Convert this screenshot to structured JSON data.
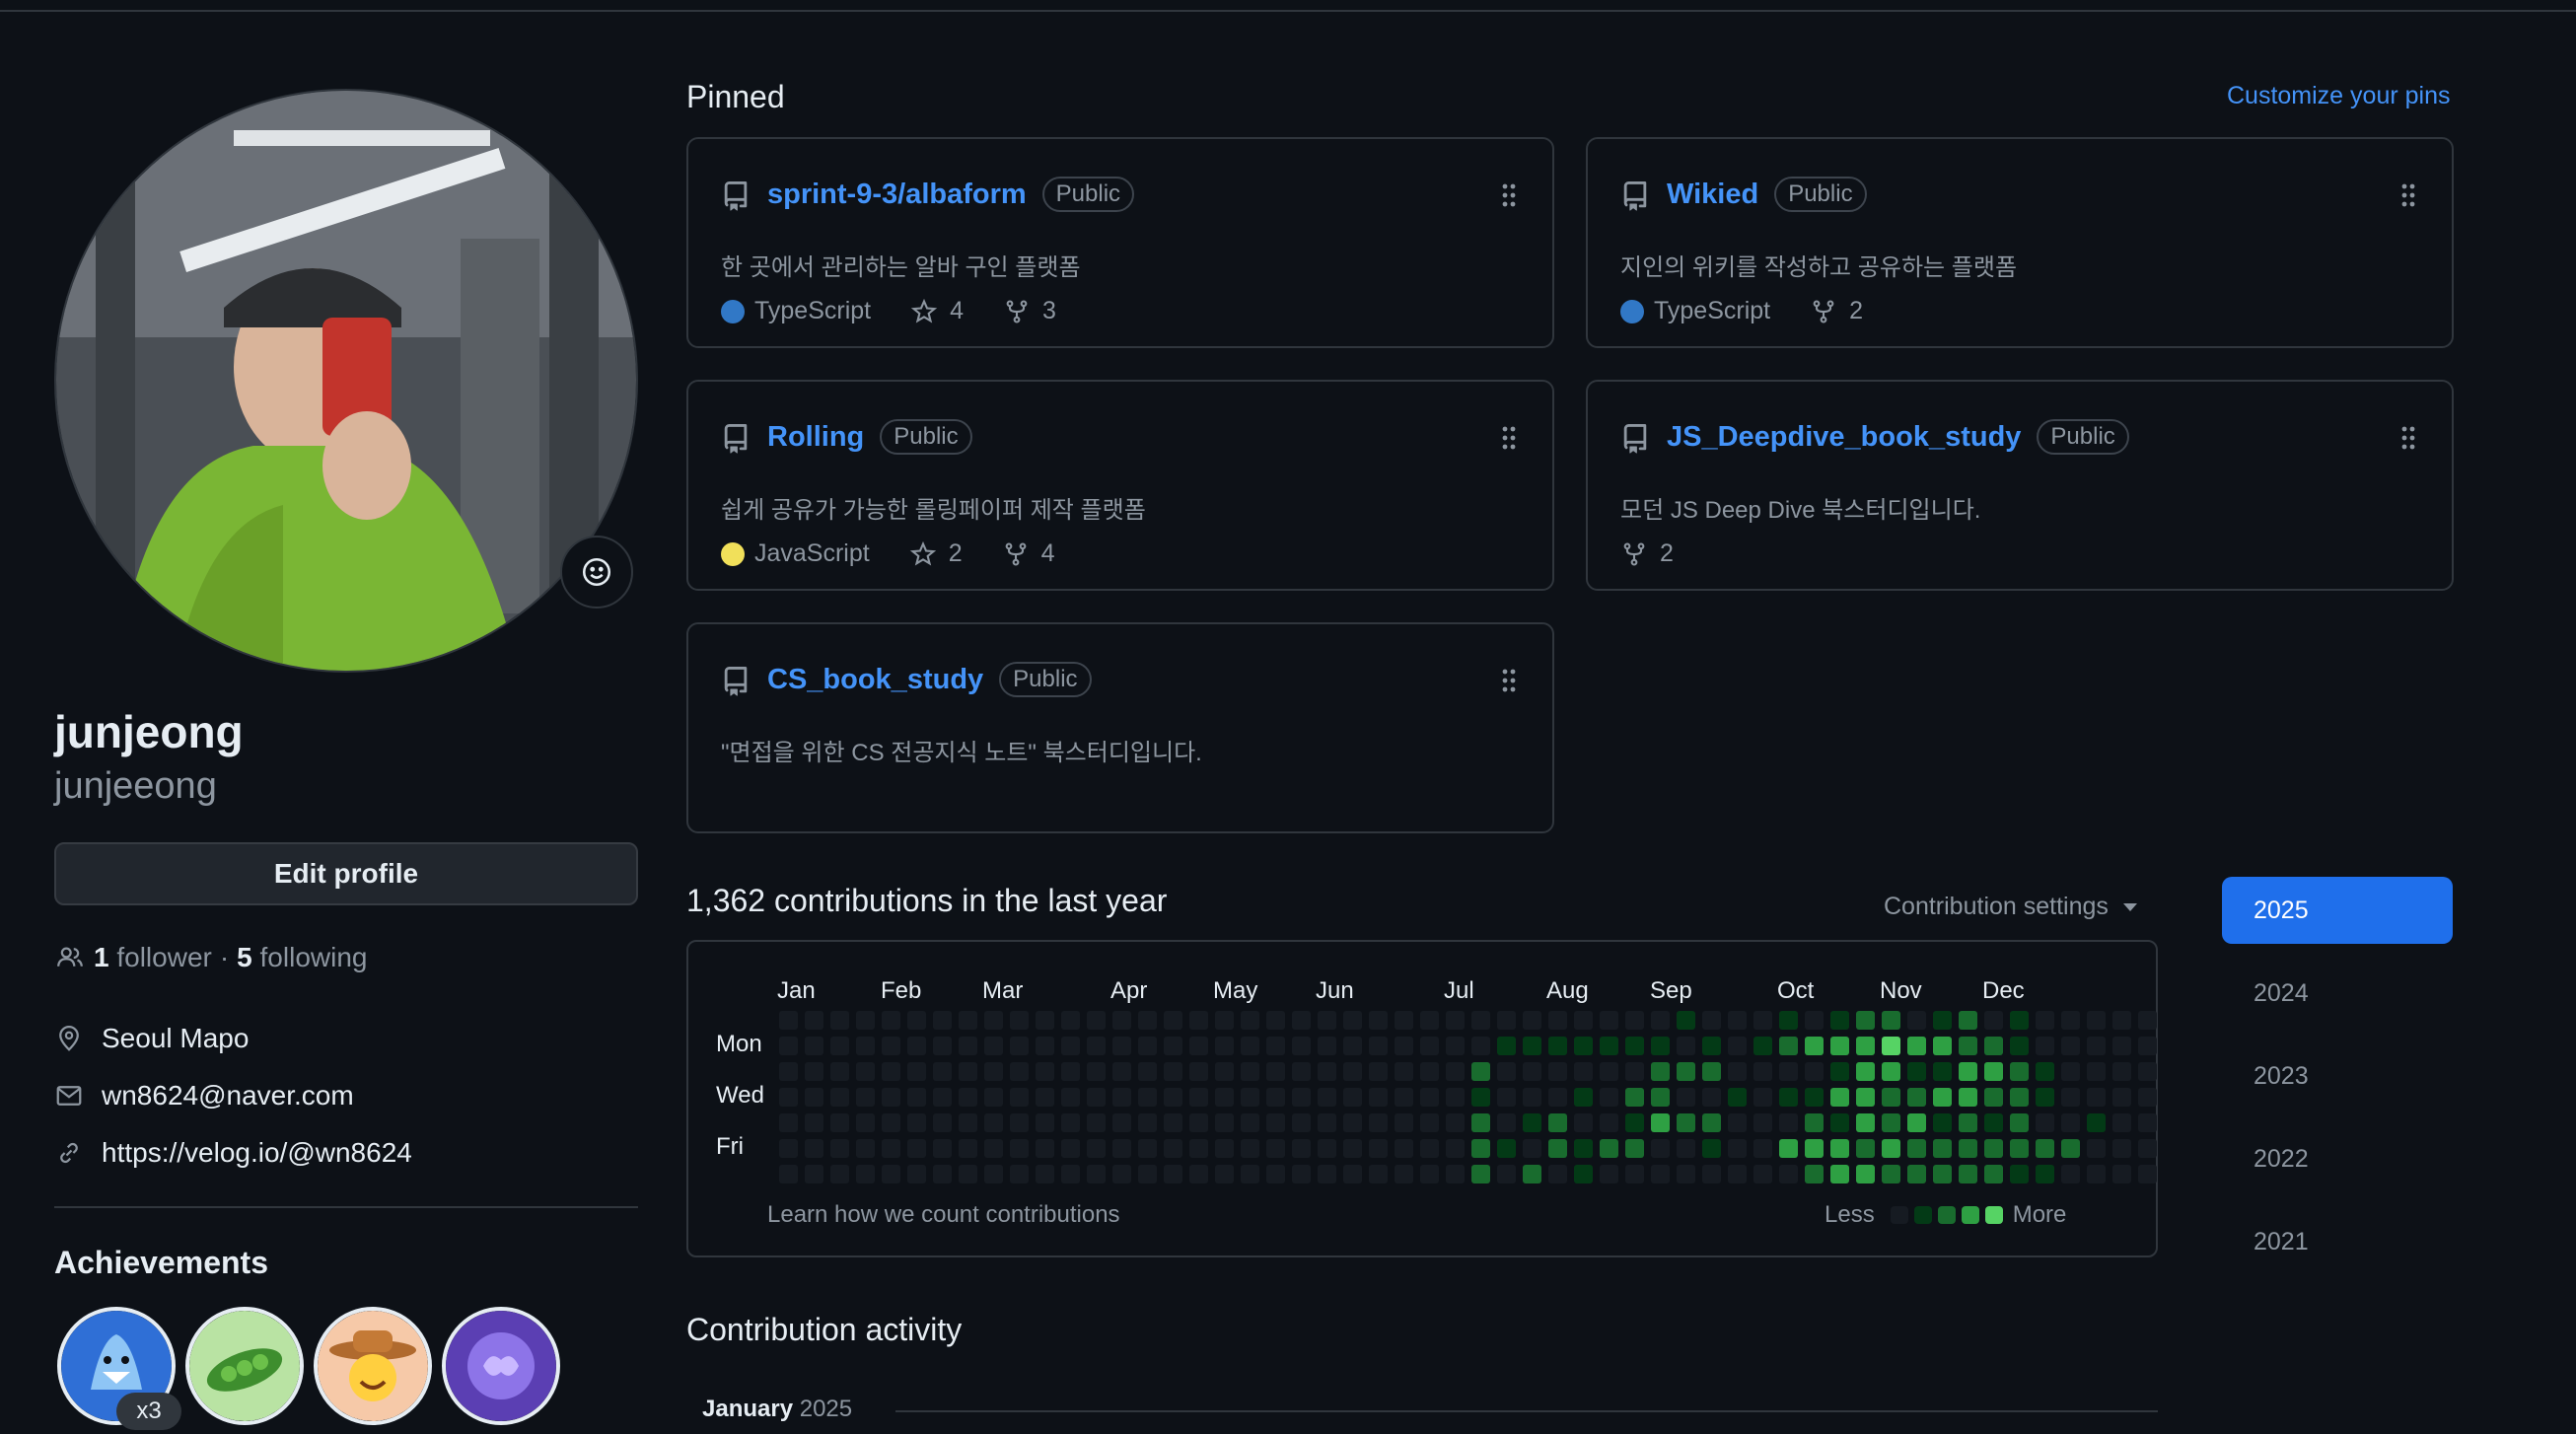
{
  "profile": {
    "name": "junjeong",
    "login": "junjeeong",
    "edit_label": "Edit profile",
    "followers": "1",
    "followers_label": "follower",
    "following": "5",
    "following_label": "following",
    "location": "Seoul Mapo",
    "email": "wn8624@naver.com",
    "website": "https://velog.io/@wn8624"
  },
  "achievements": {
    "title": "Achievements",
    "badges": [
      "badge-shark",
      "badge-pea-pod",
      "badge-cowboy",
      "badge-brain"
    ],
    "multiplier": "x3"
  },
  "pinned": {
    "title": "Pinned",
    "customize": "Customize your pins",
    "repos": [
      {
        "name": "sprint-9-3/albaform",
        "visibility": "Public",
        "description": "한 곳에서 관리하는 알바 구인 플랫폼",
        "language": "TypeScript",
        "lang_color": "#3178c6",
        "stars": "4",
        "forks": "3"
      },
      {
        "name": "Wikied",
        "visibility": "Public",
        "description": "지인의 위키를 작성하고 공유하는 플랫폼",
        "language": "TypeScript",
        "lang_color": "#3178c6",
        "forks": "2"
      },
      {
        "name": "Rolling",
        "visibility": "Public",
        "description": "쉽게 공유가 가능한 롤링페이퍼 제작 플랫폼",
        "language": "JavaScript",
        "lang_color": "#f1e05a",
        "stars": "2",
        "forks": "4"
      },
      {
        "name": "JS_Deepdive_book_study",
        "visibility": "Public",
        "description": "모던 JS Deep Dive 북스터디입니다.",
        "forks": "2"
      },
      {
        "name": "CS_book_study",
        "visibility": "Public",
        "description": "\"면접을 위한 CS 전공지식 노트\" 북스터디입니다."
      }
    ]
  },
  "contributions": {
    "title": "1,362 contributions in the last year",
    "settings": "Contribution settings",
    "months": [
      "Jan",
      "Feb",
      "Mar",
      "Apr",
      "May",
      "Jun",
      "Jul",
      "Aug",
      "Sep",
      "Oct",
      "Nov",
      "Dec"
    ],
    "days": [
      "Mon",
      "Wed",
      "Fri"
    ],
    "learn": "Learn how we count contributions",
    "less": "Less",
    "more": "More",
    "level_colors": [
      "#161b22",
      "#033a16",
      "#196c2e",
      "#2ea043",
      "#56d364"
    ],
    "cell_levels": [
      "0000000000000000000000000000000000010001012201201000000",
      "0000000000000000000000000000111111101012333433221000000",
      "0000000000000000000000000002000000222000013311332100000",
      "0000000000000000000000000001000102200101133223322100000",
      "0000000000000000000000000002012001322000213231212001000",
      "0000000000000000000000000002102122001003332322222220000",
      "0000000000000000000000000002020100000000233222221100000"
    ]
  },
  "years": [
    "2025",
    "2024",
    "2023",
    "2022",
    "2021"
  ],
  "activity": {
    "title": "Contribution activity",
    "month": "January",
    "year": "2025"
  }
}
